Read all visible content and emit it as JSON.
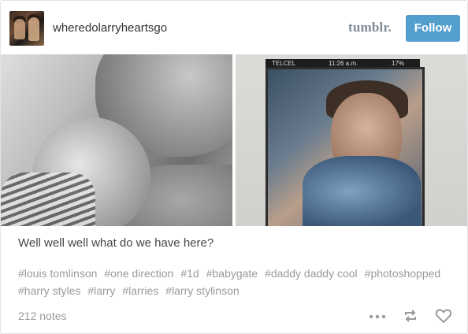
{
  "header": {
    "blog_name": "wheredolarryheartsgo",
    "logo_text": "tumblr.",
    "follow_label": "Follow",
    "avatar_icon": "blog-avatar"
  },
  "photos": {
    "right_status_left": "TELCEL",
    "right_status_time": "11:26 a.m.",
    "right_status_battery": "17%"
  },
  "post": {
    "caption": "Well well well what do we have here?",
    "tags": [
      "#louis tomlinson",
      "#one direction",
      "#1d",
      "#babygate",
      "#daddy daddy cool",
      "#photoshopped",
      "#harry styles",
      "#larry",
      "#larries",
      "#larry stylinson"
    ]
  },
  "footer": {
    "notes": "212 notes",
    "icons": [
      "more-icon",
      "reblog-icon",
      "heart-icon"
    ]
  },
  "colors": {
    "follow_button": "#529ecc",
    "logo": "#7f8a96",
    "muted_text": "#9a9a9a",
    "body_text": "#444444"
  }
}
